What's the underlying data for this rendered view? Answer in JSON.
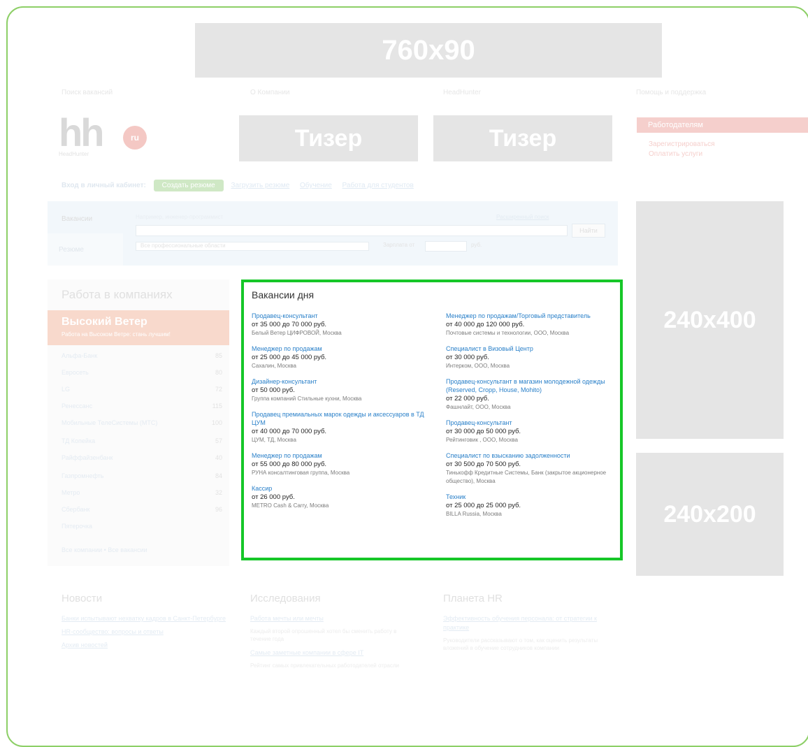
{
  "banner": {
    "label": "760x90"
  },
  "top_links": [
    "Поиск вакансий",
    "О Компании",
    "HeadHunter",
    "Помощь и поддержка"
  ],
  "logo": {
    "main": "hh",
    "badge": "ru",
    "subtitle": "HeadHunter"
  },
  "teasers": [
    "Тизер",
    "Тизер"
  ],
  "employer": {
    "button": "Работодателям",
    "links": [
      "Зарегистрироваться",
      "Оплатить услуги"
    ]
  },
  "login_bar": {
    "label": "Вход в личный кабинет:",
    "primary": "Создать резюме",
    "links": [
      "Загрузить резюме",
      "Обучение",
      "Работа для студентов"
    ]
  },
  "search": {
    "tab_vacancies": "Вакансии",
    "tab_resumes": "Резюме",
    "hint": "Например, инженер-программист",
    "advanced": "Расширенный поиск",
    "button": "Найти",
    "region": "Все профессиональные области",
    "salary_label": "Зарплата от",
    "currency": "руб."
  },
  "companies": {
    "title": "Работа в компаниях",
    "featured": {
      "name": "Высокий Ветер",
      "subtitle": "Работа на Высоком Ветре: стань лучшим!"
    },
    "rows": [
      {
        "name": "Альфа-Банк",
        "count": "85"
      },
      {
        "name": "Евросеть",
        "count": "80"
      },
      {
        "name": "LG",
        "count": "72"
      },
      {
        "name": "Ренессанс",
        "count": "115"
      },
      {
        "name": "Мобильные ТелеСистемы (МТС)",
        "count": "100"
      },
      {
        "name": "ТД Копейка",
        "count": "57"
      },
      {
        "name": "Райффайзенбанк",
        "count": "40"
      },
      {
        "name": "Газпромнефть",
        "count": "84"
      },
      {
        "name": "Метро",
        "count": "32"
      },
      {
        "name": "Сбербанк",
        "count": "96"
      },
      {
        "name": "Пятерочка",
        "count": ""
      }
    ],
    "footer": "Все компании  •  Все вакансии"
  },
  "vacancies": {
    "title": "Вакансии дня",
    "left": [
      {
        "title": "Продавец-консультант",
        "pay": "от 35 000 до 70 000 руб.",
        "company": "Белый Ветер ЦИФРОВОЙ, Москва"
      },
      {
        "title": "Менеджер по продажам",
        "pay": "от 25 000 до 45 000 руб.",
        "company": "Сахалин, Москва"
      },
      {
        "title": "Дизайнер-консультант",
        "pay": "от 50 000 руб.",
        "company": "Группа компаний Стильные кухни, Москва"
      },
      {
        "title": "Продавец премиальных марок одежды и аксессуаров в ТД ЦУМ",
        "pay": "от 40 000 до 70 000 руб.",
        "company": "ЦУМ, ТД, Москва"
      },
      {
        "title": "Менеджер по продажам",
        "pay": "от 55 000 до 80 000 руб.",
        "company": "РУНА консалтинговая группа, Москва"
      },
      {
        "title": "Кассир",
        "pay": "от 26 000 руб.",
        "company": "METRO Cash & Carry, Москва"
      }
    ],
    "right": [
      {
        "title": "Менеджер по продажам/Торговый представитель",
        "pay": "от 40 000 до 120 000 руб.",
        "company": "Почтовые системы и технологии, ООО, Москва"
      },
      {
        "title": "Специалист в Визовый Центр",
        "pay": "от 30 000 руб.",
        "company": "Интерком, ООО, Москва"
      },
      {
        "title": "Продавец-консультант в магазин молодежной одежды (Reserved, Cropp, House, Mohito)",
        "pay": "от 22 000 руб.",
        "company": "Фашнлайт, ООО, Москва"
      },
      {
        "title": "Продавец-консультант",
        "pay": "от 30 000 до 50 000 руб.",
        "company": "Рейтинговик , ООО, Москва"
      },
      {
        "title": "Специалист по взысканию задолженности",
        "pay": "от 30 500 до 70 500 руб.",
        "company": "Тинькофф Кредитные Системы, Банк (закрытое акционерное общество), Москва"
      },
      {
        "title": "Техник",
        "pay": "от 25 000 до 25 000 руб.",
        "company": "BILLA Russia, Москва"
      }
    ]
  },
  "ads": {
    "tall": "240x400",
    "small": "240x200"
  },
  "bottom": {
    "news": {
      "title": "Новости",
      "links": [
        "Банки испытывают нехватку кадров в Санкт-Петербурге",
        "HR-сообщество: вопросы и ответы",
        "Архив новостей"
      ]
    },
    "research": {
      "title": "Исследования",
      "items": [
        {
          "link": "Работа мечты или мечты",
          "desc": "Каждый второй опрошенный хотел бы сменить работу в течение года"
        },
        {
          "link": "Самые заметные компании в сфере IT",
          "desc": "Рейтинг самых привлекательных работодателей отрасли"
        }
      ]
    },
    "planet": {
      "title": "Планета HR",
      "items": [
        {
          "link": "Эффективность обучения персонала: от стратегии к практике",
          "desc": "Руководители рассказывают о том, как оценить результаты вложений в обучение сотрудников компании"
        }
      ]
    }
  }
}
